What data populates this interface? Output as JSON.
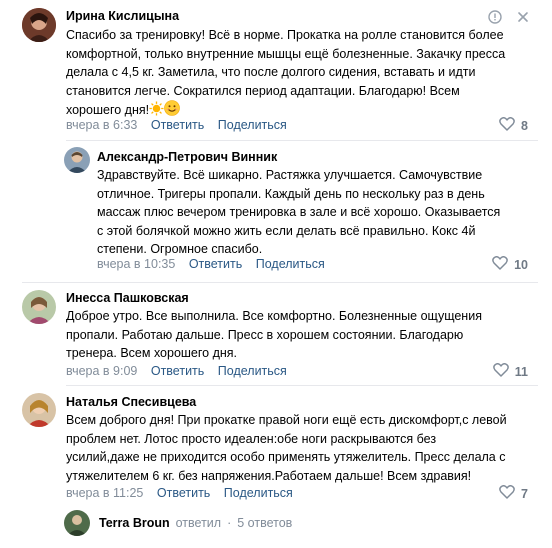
{
  "comments": [
    {
      "author": "Ирина Кислицына",
      "lines": [
        "Спасибо за тренировку! Всё в норме. Прокатка на ролле становится более",
        "комфортной, только внутренние мышцы ещё болезненные. Закачку пресса",
        "делала с 4,5 кг. Заметила, что после долгого сидения, вставать и идти",
        "становится легче. Сократился период адаптации. Благодарю! Всем",
        "хорошего дня!"
      ],
      "time": "вчера в 6:33",
      "reply_label": "Ответить",
      "share_label": "Поделиться",
      "likes": "8"
    },
    {
      "author": "Александр-Петрович Винник",
      "lines": [
        "Здравствуйте. Всё шикарно. Растяжка улучшается. Самочувствие",
        "отличное. Тригеры пропали. Каждый день по нескольку раз в день",
        "массаж плюс вечером тренировка в зале и всё хорошо. Оказывается",
        "с этой болячкой можно жить если делать всё правильно. Кокс 4й",
        "степени. Огромное спасибо."
      ],
      "time": "вчера в 10:35",
      "reply_label": "Ответить",
      "share_label": "Поделиться",
      "likes": "10"
    },
    {
      "author": "Инесса Пашковская",
      "lines": [
        "Доброе утро. Все выполнила. Все комфортно. Болезненные ощущения",
        "пропали. Работаю дальше. Пресс в хорошем состоянии. Благодарю",
        "тренера. Всем хорошего дня."
      ],
      "time": "вчера в 9:09",
      "reply_label": "Ответить",
      "share_label": "Поделиться",
      "likes": "11"
    },
    {
      "author": "Наталья Спесивцева",
      "lines": [
        "Всем доброго дня! При прокатке правой ноги ещё есть дискомфорт,с левой",
        "проблем нет. Лотос просто идеален:обе ноги раскрываются без",
        "усилий,даже не приходится особо применять утяжелитель. Пресс делала с",
        "утяжелителем 6 кг. без напряжения.Работаем дальше! Всем здравия!"
      ],
      "time": "вчера в 11:25",
      "reply_label": "Ответить",
      "share_label": "Поделиться",
      "likes": "7"
    }
  ],
  "replies_thread": {
    "author": "Terra Broun",
    "action": "ответил",
    "separator": "·",
    "count": "5 ответов"
  },
  "icons": {
    "report": "report-icon",
    "close": "close-icon",
    "like": "heart-icon",
    "sun_emoji": "sun-emoji",
    "smile_emoji": "smile-emoji"
  },
  "colors": {
    "link": "#2a5885",
    "meta": "#818c99",
    "divider": "#e7e8ec"
  }
}
